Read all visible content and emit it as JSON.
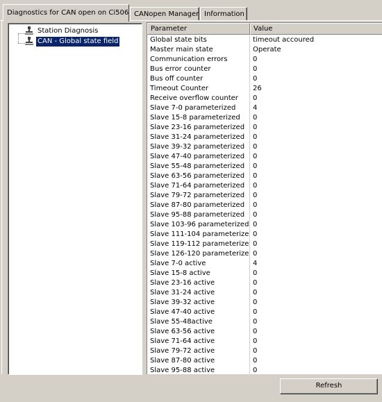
{
  "tabs": [
    {
      "label": "Diagnostics for CAN open on Ci506",
      "active": true
    },
    {
      "label": "CANopen Manager",
      "active": false
    },
    {
      "label": "Information",
      "active": false
    }
  ],
  "tree": {
    "items": [
      {
        "label": "Station Diagnosis",
        "icon": "device-icon",
        "selected": false
      },
      {
        "label": "CAN - Global state field",
        "icon": "device-icon",
        "selected": true
      }
    ]
  },
  "grid": {
    "columns": [
      "Parameter",
      "Value"
    ],
    "rows": [
      [
        "Global state bits",
        "timeout accoured"
      ],
      [
        "Master main state",
        "Operate"
      ],
      [
        "Communication errors",
        "0"
      ],
      [
        "Bus error counter",
        "0"
      ],
      [
        "Bus off counter",
        "0"
      ],
      [
        "Timeout Counter",
        "26"
      ],
      [
        "Receive overflow counter",
        "0"
      ],
      [
        "Slave 7-0 parameterized",
        "4"
      ],
      [
        "Slave 15-8 parameterized",
        "0"
      ],
      [
        "Slave 23-16 parameterized",
        "0"
      ],
      [
        "Slave 31-24 parameterized",
        "0"
      ],
      [
        "Slave 39-32 parameterized",
        "0"
      ],
      [
        "Slave 47-40 parameterized",
        "0"
      ],
      [
        "Slave 55-48 parameterized",
        "0"
      ],
      [
        "Slave 63-56 parameterized",
        "0"
      ],
      [
        "Slave 71-64 parameterized",
        "0"
      ],
      [
        "Slave 79-72 parameterized",
        "0"
      ],
      [
        "Slave 87-80 parameterized",
        "0"
      ],
      [
        "Slave 95-88 parameterized",
        "0"
      ],
      [
        "Slave 103-96 parameterized",
        "0"
      ],
      [
        "Slave 111-104 parameterized",
        "0"
      ],
      [
        "Slave 119-112 parameterized",
        "0"
      ],
      [
        "Slave 126-120 parameterized",
        "0"
      ],
      [
        "Slave 7-0 active",
        "4"
      ],
      [
        "Slave 15-8 active",
        "0"
      ],
      [
        "Slave 23-16 active",
        "0"
      ],
      [
        "Slave 31-24 active",
        "0"
      ],
      [
        "Slave 39-32 active",
        "0"
      ],
      [
        "Slave 47-40 active",
        "0"
      ],
      [
        "Slave 55-48active",
        "0"
      ],
      [
        "Slave 63-56 active",
        "0"
      ],
      [
        "Slave 71-64 active",
        "0"
      ],
      [
        "Slave 79-72 active",
        "0"
      ],
      [
        "Slave 87-80 active",
        "0"
      ],
      [
        "Slave 95-88 active",
        "0"
      ]
    ]
  },
  "buttons": {
    "refresh_label": "Refresh"
  },
  "colors": {
    "face": "#d4d0c8",
    "selection": "#0a246a"
  }
}
